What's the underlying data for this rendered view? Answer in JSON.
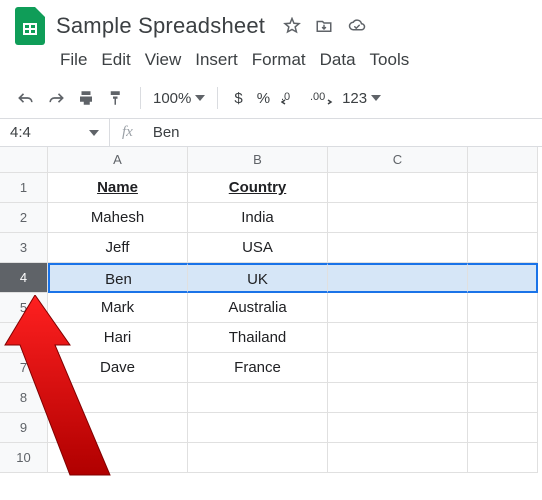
{
  "header": {
    "title": "Sample Spreadsheet"
  },
  "menubar": {
    "file": "File",
    "edit": "Edit",
    "view": "View",
    "insert": "Insert",
    "format": "Format",
    "data": "Data",
    "tools": "Tools"
  },
  "toolbar": {
    "zoom": "100%",
    "currency": "$",
    "percent": "%",
    "dec_minus": ".0",
    "dec_plus": ".00",
    "more_formats": "123"
  },
  "namebox": {
    "ref": "4:4"
  },
  "formula": {
    "fx": "fx",
    "value": "Ben"
  },
  "columns": [
    "A",
    "B",
    "C"
  ],
  "rows": [
    "1",
    "2",
    "3",
    "4",
    "5",
    "6",
    "7",
    "8",
    "9",
    "10"
  ],
  "cells": {
    "a1": "Name",
    "b1": "Country",
    "a2": "Mahesh",
    "b2": "India",
    "a3": "Jeff",
    "b3": "USA",
    "a4": "Ben",
    "b4": "UK",
    "a5": "Mark",
    "b5": "Australia",
    "a6": "Hari",
    "b6": "Thailand",
    "a7": "Dave",
    "b7": "France"
  },
  "selected_row": 4
}
